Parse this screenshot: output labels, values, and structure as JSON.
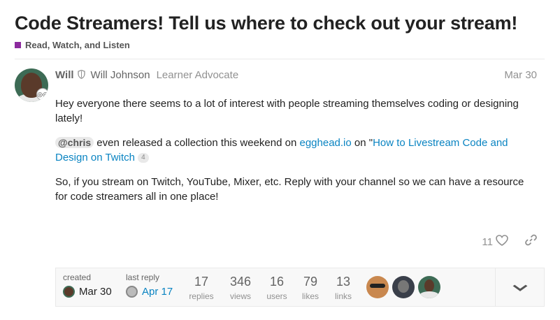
{
  "topic": {
    "title": "Code Streamers! Tell us where to check out your stream!",
    "category": "Read, Watch, and Listen",
    "category_color": "#8c2a9e"
  },
  "post": {
    "username": "Will",
    "full_name": "Will Johnson",
    "user_title": "Learner Advocate",
    "date": "Mar 30",
    "paragraph1": "Hey everyone there seems to a lot of interest with people streaming themselves coding or designing lately!",
    "mention": "@chris",
    "p2_text1": " even released a collection this weekend on ",
    "p2_link1": "egghead.io",
    "p2_text2": " on \"",
    "p2_link2": "How to Livestream Code and Design on Twitch",
    "p2_link_count": "4",
    "paragraph3": "So, if you stream on Twitch, YouTube, Mixer, etc. Reply with your channel so we can have a resource for code streamers all in one place!",
    "like_count": "11"
  },
  "topic_map": {
    "created_label": "created",
    "created_date": "Mar 30",
    "last_reply_label": "last reply",
    "last_reply_date": "Apr 17",
    "stats": [
      {
        "num": "17",
        "label": "replies"
      },
      {
        "num": "346",
        "label": "views"
      },
      {
        "num": "16",
        "label": "users"
      },
      {
        "num": "79",
        "label": "likes"
      },
      {
        "num": "13",
        "label": "links"
      }
    ]
  },
  "icons": {
    "shield": "shield-icon",
    "heart": "heart-icon",
    "share": "link-icon",
    "chevron": "chevron-down-icon"
  }
}
